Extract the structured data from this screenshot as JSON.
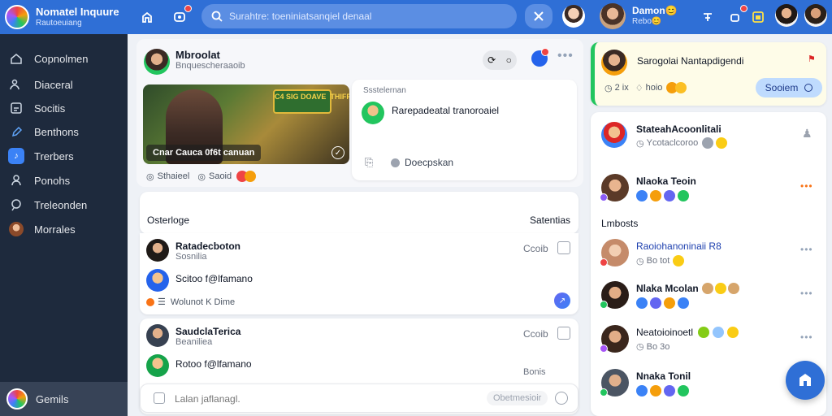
{
  "app": {
    "title": "Nomatel Inquure",
    "subtitle": "Rautoeuiang"
  },
  "topbar": {
    "search_placeholder": "Surahtre: toeniniatsanqiel denaal",
    "user_name": "Damon😊",
    "user_sub": "Rebo😊"
  },
  "sidebar": {
    "items": [
      {
        "label": "Copnolmen",
        "icon": "home-icon"
      },
      {
        "label": "Diaceral",
        "icon": "users-icon"
      },
      {
        "label": "Socitis",
        "icon": "grid-icon"
      },
      {
        "label": "Benthons",
        "icon": "edit-icon"
      },
      {
        "label": "Trerbers",
        "icon": "music-icon"
      },
      {
        "label": "Ponohs",
        "icon": "people-icon"
      },
      {
        "label": "Treleonden",
        "icon": "chat-icon"
      },
      {
        "label": "Morrales",
        "icon": "avatar-icon"
      }
    ],
    "footer_label": "Gemils"
  },
  "post": {
    "author": "Mbroolat",
    "sub": "Bnquescheraaoib",
    "hero_caption": "Cnar Cauca 0f6t canuan",
    "hero_sign": "C4 SIG DOAVE  THIFF",
    "stat_a": "Sthaieel",
    "stat_b": "Saoid"
  },
  "notice": {
    "title": "Ssstelernan",
    "body": "Rarepadeatal tranoroaiel",
    "action": "Doecpskan"
  },
  "comments": {
    "header_left": "Osterloge",
    "header_right": "Satentias",
    "items": [
      {
        "name": "Ratadecboton",
        "sub": "Sosnilia",
        "time": "Ccoib",
        "reply_name": "Scitoo f@lfamano",
        "meta": "Wolunot K Dime"
      },
      {
        "name": "SaudclaTerica",
        "sub": "Beaniliea",
        "time": "Ccoib",
        "reply_name": "Rotoo f@lfamano",
        "meta": "Bonis"
      }
    ],
    "input_placeholder": "Lalan jaflanagl.",
    "send_label": "Obetmesioir"
  },
  "right": {
    "highlight": {
      "title": "Sarogolai Nantapdigendi",
      "meta_a": "2 ix",
      "meta_b": "hoio",
      "button": "Sooiem"
    },
    "top": {
      "name": "StateahAcoonlitali",
      "sub": "Ycotaclcoroo"
    },
    "people": [
      {
        "name": "Nlaoka Teoin",
        "section": ""
      },
      {
        "name": "Raoiohanoninaii R8",
        "sub": "Bo tot"
      },
      {
        "name": "Nlaka Mcolan"
      },
      {
        "name": "Neatoioinoetl",
        "sub": "Bo 3o"
      },
      {
        "name": "Nnaka Tonil"
      }
    ],
    "section_label": "Lmbosts"
  },
  "colors": {
    "topbar": "#2f6fd6",
    "sidebar": "#1e2a3d",
    "accent": "#3b82f6",
    "highlight_bar": "#22c55e"
  }
}
